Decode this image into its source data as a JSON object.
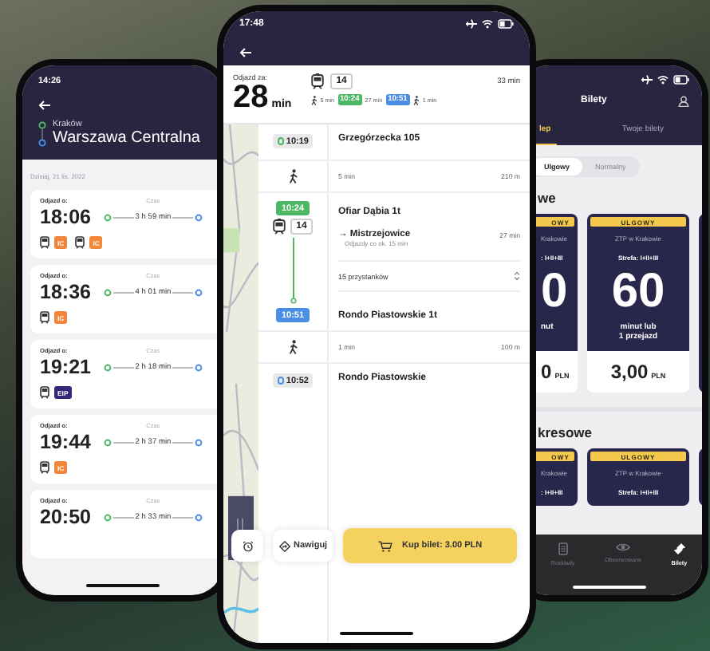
{
  "left_phone": {
    "status_time": "14:26",
    "origin": "Kraków",
    "destination": "Warszawa Centralna",
    "date": "Dzisiaj, 21 lis. 2022",
    "connections": [
      {
        "departure_label": "Odjazd o:",
        "departure": "18:06",
        "duration_label": "Czas",
        "duration": "3 h 59 min",
        "trains": [
          {
            "category": "IC",
            "color": "#f0873a"
          },
          {
            "category": "IC",
            "color": "#f0873a"
          }
        ]
      },
      {
        "departure_label": "Odjazd o:",
        "departure": "18:36",
        "duration_label": "Czas",
        "duration": "4 h 01 min",
        "trains": [
          {
            "category": "IC",
            "color": "#f0873a"
          }
        ]
      },
      {
        "departure_label": "Odjazd o:",
        "departure": "19:21",
        "duration_label": "Czas",
        "duration": "2 h 18 min",
        "trains": [
          {
            "category": "EIP",
            "color": "#35277a"
          }
        ]
      },
      {
        "departure_label": "Odjazd o:",
        "departure": "19:44",
        "duration_label": "Czas",
        "duration": "2 h 37 min",
        "trains": [
          {
            "category": "IC",
            "color": "#f0873a"
          }
        ]
      },
      {
        "departure_label": "Odjazd o:",
        "departure": "20:50",
        "duration_label": "Czas",
        "duration": "2 h 33 min"
      }
    ]
  },
  "center_phone": {
    "status_time": "17:48",
    "summary": {
      "departure_label": "Odjazd za:",
      "minutes": "28",
      "minutes_unit": "min",
      "line": "14",
      "total": "33 min",
      "segments": [
        {
          "kind": "walk",
          "text": "5 min"
        },
        {
          "kind": "time",
          "text": "10:24",
          "color": "#4cb865"
        },
        {
          "kind": "ride",
          "text": "27 min"
        },
        {
          "kind": "time",
          "text": "10:51",
          "color": "#4a8ee6"
        },
        {
          "kind": "walk",
          "text": "1 min"
        }
      ]
    },
    "steps": [
      {
        "kind": "stop",
        "time": "10:19",
        "color": "#4cb865",
        "name": "Grzegórzecka 105"
      },
      {
        "kind": "walk",
        "duration": "5 min",
        "distance": "210 m"
      },
      {
        "kind": "ride",
        "time": "10:24",
        "line": "14",
        "name": "Ofiar Dąbia 1t",
        "direction": "→ Mistrzejowice",
        "ride_time": "27 min",
        "frequency": "Odjazdy co ok. 15 min",
        "stops": "15 przystanków",
        "end_time": "10:51",
        "end_name": "Rondo Piastowskie 1t"
      },
      {
        "kind": "walk",
        "duration": "1 min",
        "distance": "100 m"
      },
      {
        "kind": "stop",
        "time": "10:52",
        "color": "#4a8ee6",
        "name": "Rondo Piastowskie"
      }
    ],
    "navigate": "Nawiguj",
    "buy": "Kup bilet: 3.00 PLN"
  },
  "right_phone": {
    "title": "Bilety",
    "tabs": [
      {
        "label": "lep",
        "selected": true
      },
      {
        "label": "Twoje bilety",
        "selected": false
      }
    ],
    "fare_types": [
      {
        "label": "Ulgowy",
        "selected": true
      },
      {
        "label": "Normalny",
        "selected": false
      }
    ],
    "sections": [
      {
        "heading": "we",
        "tickets": [
          {
            "badge": "OWY",
            "operator": "Krakowie",
            "zone": ": I+II+III",
            "value": "0",
            "unit": "nut",
            "price": "0",
            "currency": "PLN"
          },
          {
            "badge": "ULGOWY",
            "operator": "ZTP w Krakowie",
            "zone": "Strefa: I+II+III",
            "value": "60",
            "unit": "minut lub\n1 przejazd",
            "price": "3,00",
            "currency": "PLN"
          }
        ]
      },
      {
        "heading": "kresowe",
        "tickets": [
          {
            "badge": "OWY",
            "operator": "Krakowie",
            "zone": ": I+II+III"
          },
          {
            "badge": "ULGOWY",
            "operator": "ZTP w Krakowie",
            "zone": "Strefa: I+II+III"
          }
        ]
      }
    ],
    "nav": [
      {
        "label": "Rozkłady",
        "selected": false
      },
      {
        "label": "Obserwowane",
        "selected": false
      },
      {
        "label": "Bilety",
        "selected": true
      }
    ]
  }
}
